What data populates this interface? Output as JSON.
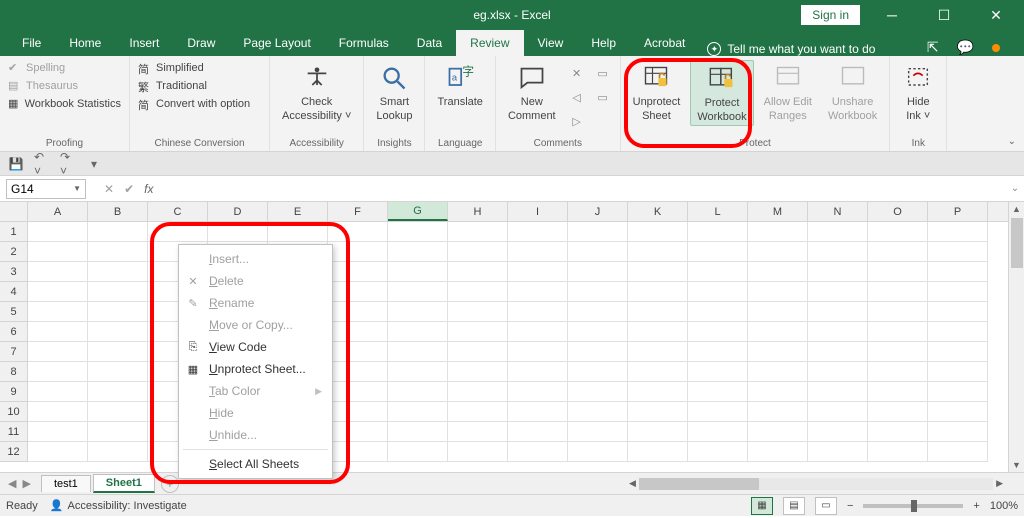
{
  "title": "eg.xlsx  -  Excel",
  "signin": "Sign in",
  "menu": {
    "file": "File",
    "home": "Home",
    "insert": "Insert",
    "draw": "Draw",
    "page_layout": "Page Layout",
    "formulas": "Formulas",
    "data": "Data",
    "review": "Review",
    "view": "View",
    "help": "Help",
    "acrobat": "Acrobat",
    "tellme": "Tell me what you want to do"
  },
  "ribbon": {
    "proofing": {
      "spelling": "Spelling",
      "thesaurus": "Thesaurus",
      "workbook_stats": "Workbook Statistics",
      "label": "Proofing"
    },
    "chinese": {
      "simplified": "Simplified",
      "traditional": "Traditional",
      "convert_option": "Convert with option",
      "label": "Chinese Conversion"
    },
    "accessibility": {
      "check": "Check",
      "check2": "Accessibility",
      "label": "Accessibility"
    },
    "insights": {
      "smart": "Smart",
      "lookup": "Lookup",
      "label": "Insights"
    },
    "language": {
      "translate": "Translate",
      "label": "Language"
    },
    "comments": {
      "new": "New",
      "comment": "Comment",
      "label": "Comments"
    },
    "protect": {
      "unprotect_sheet1": "Unprotect",
      "unprotect_sheet2": "Sheet",
      "protect_wb1": "Protect",
      "protect_wb2": "Workbook",
      "allow_edit1": "Allow Edit",
      "allow_edit2": "Ranges",
      "unshare1": "Unshare",
      "unshare2": "Workbook",
      "label": "Protect"
    },
    "ink": {
      "hide": "Hide",
      "ink": "Ink",
      "label": "Ink"
    }
  },
  "namebox": "G14",
  "fx": "fx",
  "columns": [
    "A",
    "B",
    "C",
    "D",
    "E",
    "F",
    "G",
    "H",
    "I",
    "J",
    "K",
    "L",
    "M",
    "N",
    "O",
    "P"
  ],
  "rows": [
    1,
    2,
    3,
    4,
    5,
    6,
    7,
    8,
    9,
    10,
    11,
    12
  ],
  "sheets": {
    "t1": "test1",
    "t2": "Sheet1"
  },
  "context": {
    "insert": "Insert...",
    "delete": "Delete",
    "rename": "Rename",
    "move_copy": "Move or Copy...",
    "view_code": "View Code",
    "unprotect": "Unprotect Sheet...",
    "tab_color": "Tab Color",
    "hide": "Hide",
    "unhide": "Unhide...",
    "select_all": "Select All Sheets"
  },
  "status": {
    "ready": "Ready",
    "accessibility": "Accessibility: Investigate",
    "zoom": "100%"
  }
}
